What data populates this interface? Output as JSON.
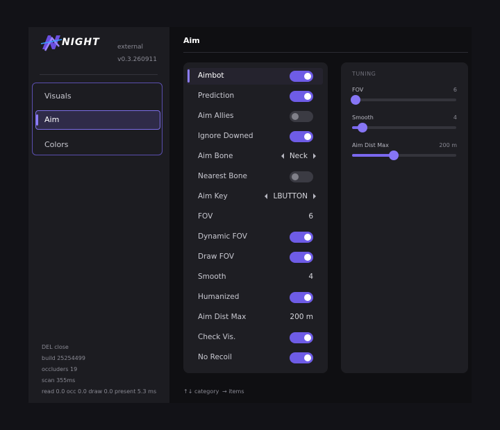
{
  "brand": {
    "name": "NIGHT",
    "edition": "external",
    "version": "v0.3.260911",
    "accent": "#7a68ee"
  },
  "nav": {
    "items": [
      {
        "label": "Visuals",
        "active": false
      },
      {
        "label": "Aim",
        "active": true
      },
      {
        "label": "Colors",
        "active": false
      }
    ]
  },
  "footer": [
    "DEL close",
    "build 25254499",
    "occluders 19",
    "scan 355ms",
    "read 0.0  occ 0.0  draw 0.0  present 5.3 ms"
  ],
  "main": {
    "title": "Aim"
  },
  "settings": [
    {
      "label": "Aimbot",
      "type": "toggle",
      "on": true,
      "active": true
    },
    {
      "label": "Prediction",
      "type": "toggle",
      "on": true
    },
    {
      "label": "Aim Allies",
      "type": "toggle",
      "on": false
    },
    {
      "label": "Ignore Downed",
      "type": "toggle",
      "on": true
    },
    {
      "label": "Aim Bone",
      "type": "enum",
      "value": "Neck"
    },
    {
      "label": "Nearest Bone",
      "type": "toggle",
      "on": false
    },
    {
      "label": "Aim Key",
      "type": "enum",
      "value": "LBUTTON"
    },
    {
      "label": "FOV",
      "type": "value",
      "value": "6"
    },
    {
      "label": "Dynamic FOV",
      "type": "toggle",
      "on": true
    },
    {
      "label": "Draw FOV",
      "type": "toggle",
      "on": true
    },
    {
      "label": "Smooth",
      "type": "value",
      "value": "4"
    },
    {
      "label": "Humanized",
      "type": "toggle",
      "on": true
    },
    {
      "label": "Aim Dist Max",
      "type": "value",
      "value": "200 m"
    },
    {
      "label": "Check Vis.",
      "type": "toggle",
      "on": true
    },
    {
      "label": "No Recoil",
      "type": "toggle",
      "on": true
    }
  ],
  "tuning": {
    "title": "TUNING",
    "sliders": [
      {
        "label": "FOV",
        "value": "6",
        "fraction": 0.03
      },
      {
        "label": "Smooth",
        "value": "4",
        "fraction": 0.1
      },
      {
        "label": "Aim Dist Max",
        "value": "200 m",
        "fraction": 0.4
      }
    ]
  },
  "hints": {
    "category": "↑↓ category",
    "items": "→ items"
  }
}
